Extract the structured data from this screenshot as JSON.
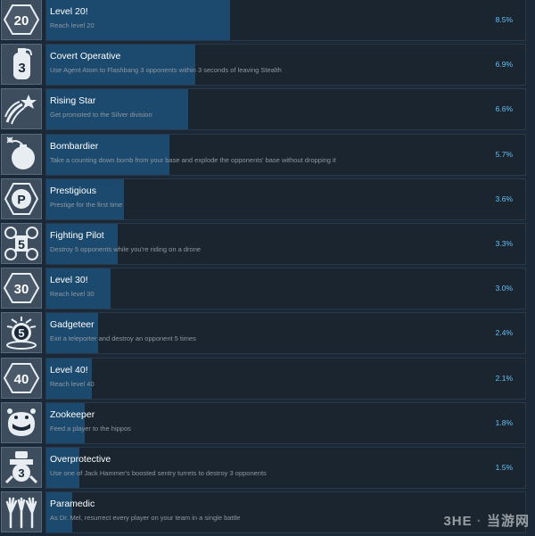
{
  "achievements": [
    {
      "name": "Level 20!",
      "desc": "Reach level 20",
      "pct": "8.5%",
      "fill": 0.085,
      "icon": "level-badge-icon",
      "badge": "20"
    },
    {
      "name": "Covert Operative",
      "desc": "Use Agent Atom to Flashbang 3 opponents within 3 seconds of leaving Stealth",
      "pct": "6.9%",
      "fill": 0.069,
      "icon": "flashbang-grenade-icon",
      "badge": "3"
    },
    {
      "name": "Rising Star",
      "desc": "Get promoted to the Silver division",
      "pct": "6.6%",
      "fill": 0.066,
      "icon": "shooting-star-icon",
      "badge": ""
    },
    {
      "name": "Bombardier",
      "desc": "Take a counting down bomb from your base and explode the opponents' base without dropping it",
      "pct": "5.7%",
      "fill": 0.057,
      "icon": "bomb-icon",
      "badge": ""
    },
    {
      "name": "Prestigious",
      "desc": "Prestige for the first time",
      "pct": "3.6%",
      "fill": 0.036,
      "icon": "prestige-p-icon",
      "badge": "P"
    },
    {
      "name": "Fighting Pilot",
      "desc": "Destroy 5 opponents while you're riding on a drone",
      "pct": "3.3%",
      "fill": 0.033,
      "icon": "drone-icon",
      "badge": "5"
    },
    {
      "name": "Level 30!",
      "desc": "Reach level 30",
      "pct": "3.0%",
      "fill": 0.03,
      "icon": "level-badge-icon",
      "badge": "30"
    },
    {
      "name": "Gadgeteer",
      "desc": "Exit a teleporter and destroy an opponent 5 times",
      "pct": "2.4%",
      "fill": 0.024,
      "icon": "teleporter-icon",
      "badge": "5"
    },
    {
      "name": "Level 40!",
      "desc": "Reach level 40",
      "pct": "2.1%",
      "fill": 0.021,
      "icon": "level-badge-icon",
      "badge": "40"
    },
    {
      "name": "Zookeeper",
      "desc": "Feed a player to the hippos",
      "pct": "1.8%",
      "fill": 0.018,
      "icon": "hippo-icon",
      "badge": ""
    },
    {
      "name": "Overprotective",
      "desc": "Use one of Jack Hammer's boosted sentry turrets to destroy 3 opponents",
      "pct": "1.5%",
      "fill": 0.015,
      "icon": "sentry-turret-icon",
      "badge": "3"
    },
    {
      "name": "Paramedic",
      "desc": "As Dr. Mel, resurrect every player on your team in a single battle",
      "pct": "",
      "fill": 0.012,
      "icon": "raised-hands-icon",
      "badge": ""
    }
  ],
  "watermark": {
    "brand": "3HE",
    "site": "当游网"
  }
}
